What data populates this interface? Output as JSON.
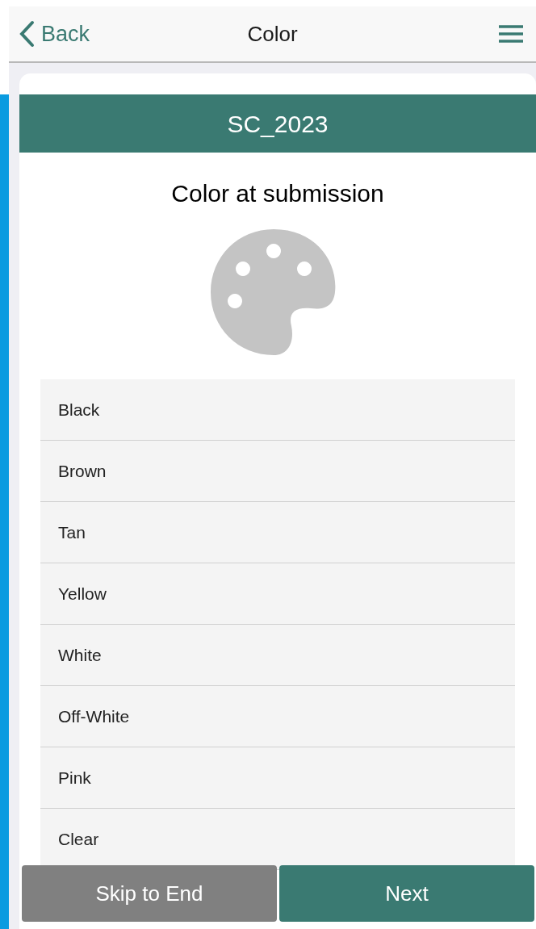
{
  "nav": {
    "back": "Back",
    "title": "Color"
  },
  "header": "SC_2023",
  "question": "Color at submission",
  "options": [
    {
      "label": "Black"
    },
    {
      "label": "Brown"
    },
    {
      "label": "Tan"
    },
    {
      "label": "Yellow"
    },
    {
      "label": "White"
    },
    {
      "label": "Off-White"
    },
    {
      "label": "Pink"
    },
    {
      "label": "Clear"
    }
  ],
  "buttons": {
    "skip": "Skip to End",
    "next": "Next"
  }
}
